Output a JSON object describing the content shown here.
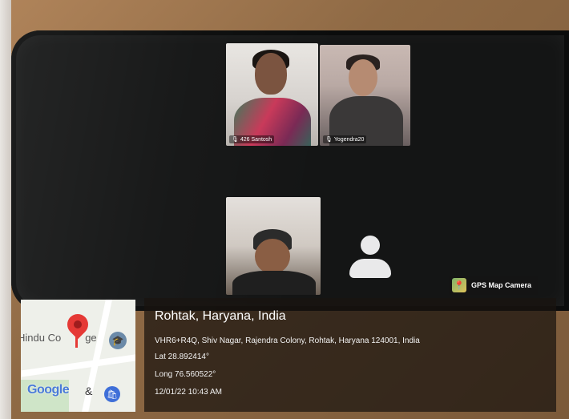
{
  "call": {
    "participants": [
      {
        "name": "426 Santosh"
      },
      {
        "name": "Yogendra20"
      }
    ]
  },
  "watermark": {
    "app_name": "GPS Map Camera",
    "icon": "gps-map-camera-icon"
  },
  "location": {
    "place": "Rohtak, Haryana, India",
    "address": "VHR6+R4Q, Shiv Nagar, Rajendra Colony, Rohtak, Haryana 124001, India",
    "lat": "Lat 28.892414°",
    "long": "Long 76.560522°",
    "datetime": "12/01/22 10:43 AM"
  },
  "map": {
    "label": "Hindu Co",
    "label_end": "ge",
    "brand": "Google",
    "amp": "&",
    "icons": [
      "location-pin-icon",
      "graduation-cap-icon",
      "shopping-bag-icon"
    ]
  }
}
